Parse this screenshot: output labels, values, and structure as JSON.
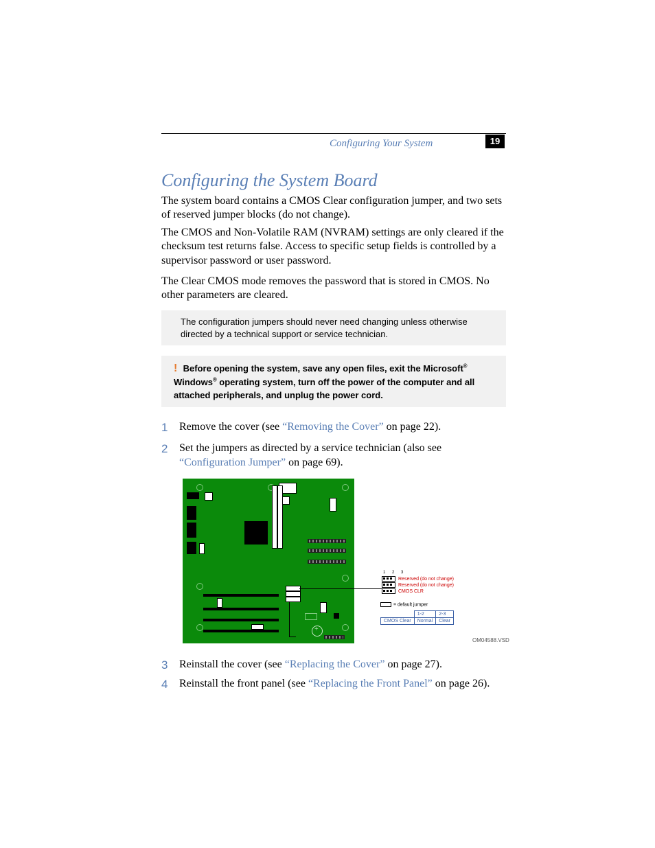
{
  "header": {
    "running_head": "Configuring Your System",
    "page_number": "19"
  },
  "title": "Configuring the System Board",
  "paragraphs": {
    "p1": "The system board contains a CMOS Clear configuration jumper, and two sets of reserved jumper blocks (do not change).",
    "p2": "The CMOS and Non-Volatile RAM (NVRAM) settings are only cleared if the checksum test returns false. Access to specific setup fields is controlled by a supervisor password or user password.",
    "p3": "The Clear CMOS mode removes the password that is stored in CMOS. No other parameters are cleared."
  },
  "note": "The configuration jumpers should never need changing unless otherwise directed by a technical support or service technician.",
  "warning": {
    "bang": "!",
    "prefix": "Before opening the system, save any open files, exit the Microsoft",
    "reg1": "®",
    "mid": " Windows",
    "reg2": "®",
    "suffix": " operating system, turn off the power of the computer and all attached peripherals, and unplug the power cord."
  },
  "steps": {
    "s1": {
      "n": "1",
      "a": "Remove the cover (see ",
      "link": "“Removing the Cover”",
      "b": " on page 22)."
    },
    "s2": {
      "n": "2",
      "a": "Set the jumpers as directed by a service technician (also see ",
      "link": "“Configuration Jumper”",
      "b": " on page 69)."
    },
    "s3": {
      "n": "3",
      "a": "Reinstall the cover (see ",
      "link": "“Replacing the Cover”",
      "b": " on page 27)."
    },
    "s4": {
      "n": "4",
      "a": "Reinstall the front panel (see ",
      "link": "“Replacing the Front Panel”",
      "b": " on page 26)."
    }
  },
  "diagram": {
    "pin_labels": "1 2 3",
    "reserved": "Reserved (do not change)",
    "cmos_clr": "CMOS CLR",
    "default_jumper": "= default jumper",
    "table": {
      "row_label": "CMOS Clear",
      "h12": "1-2",
      "h23": "2-3",
      "v12": "Normal",
      "v23": "Clear"
    },
    "file_label": "OM04588.VSD"
  }
}
